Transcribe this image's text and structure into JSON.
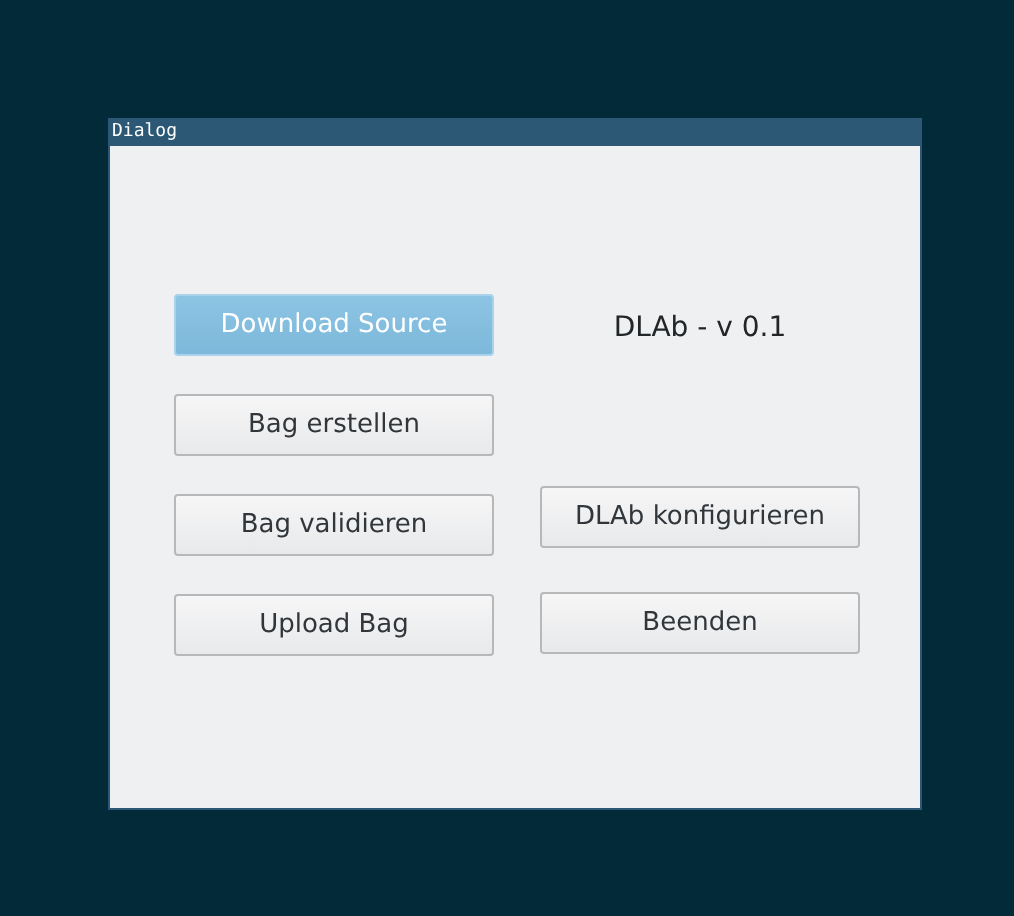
{
  "window": {
    "title": "Dialog"
  },
  "version_label": "DLAb - v 0.1",
  "left_buttons": [
    {
      "label": "Download Source",
      "highlighted": true
    },
    {
      "label": "Bag erstellen",
      "highlighted": false
    },
    {
      "label": "Bag validieren",
      "highlighted": false
    },
    {
      "label": "Upload Bag",
      "highlighted": false
    }
  ],
  "right_buttons": [
    {
      "label": "DLAb konfigurieren",
      "highlighted": false
    },
    {
      "label": "Beenden",
      "highlighted": false
    }
  ]
}
